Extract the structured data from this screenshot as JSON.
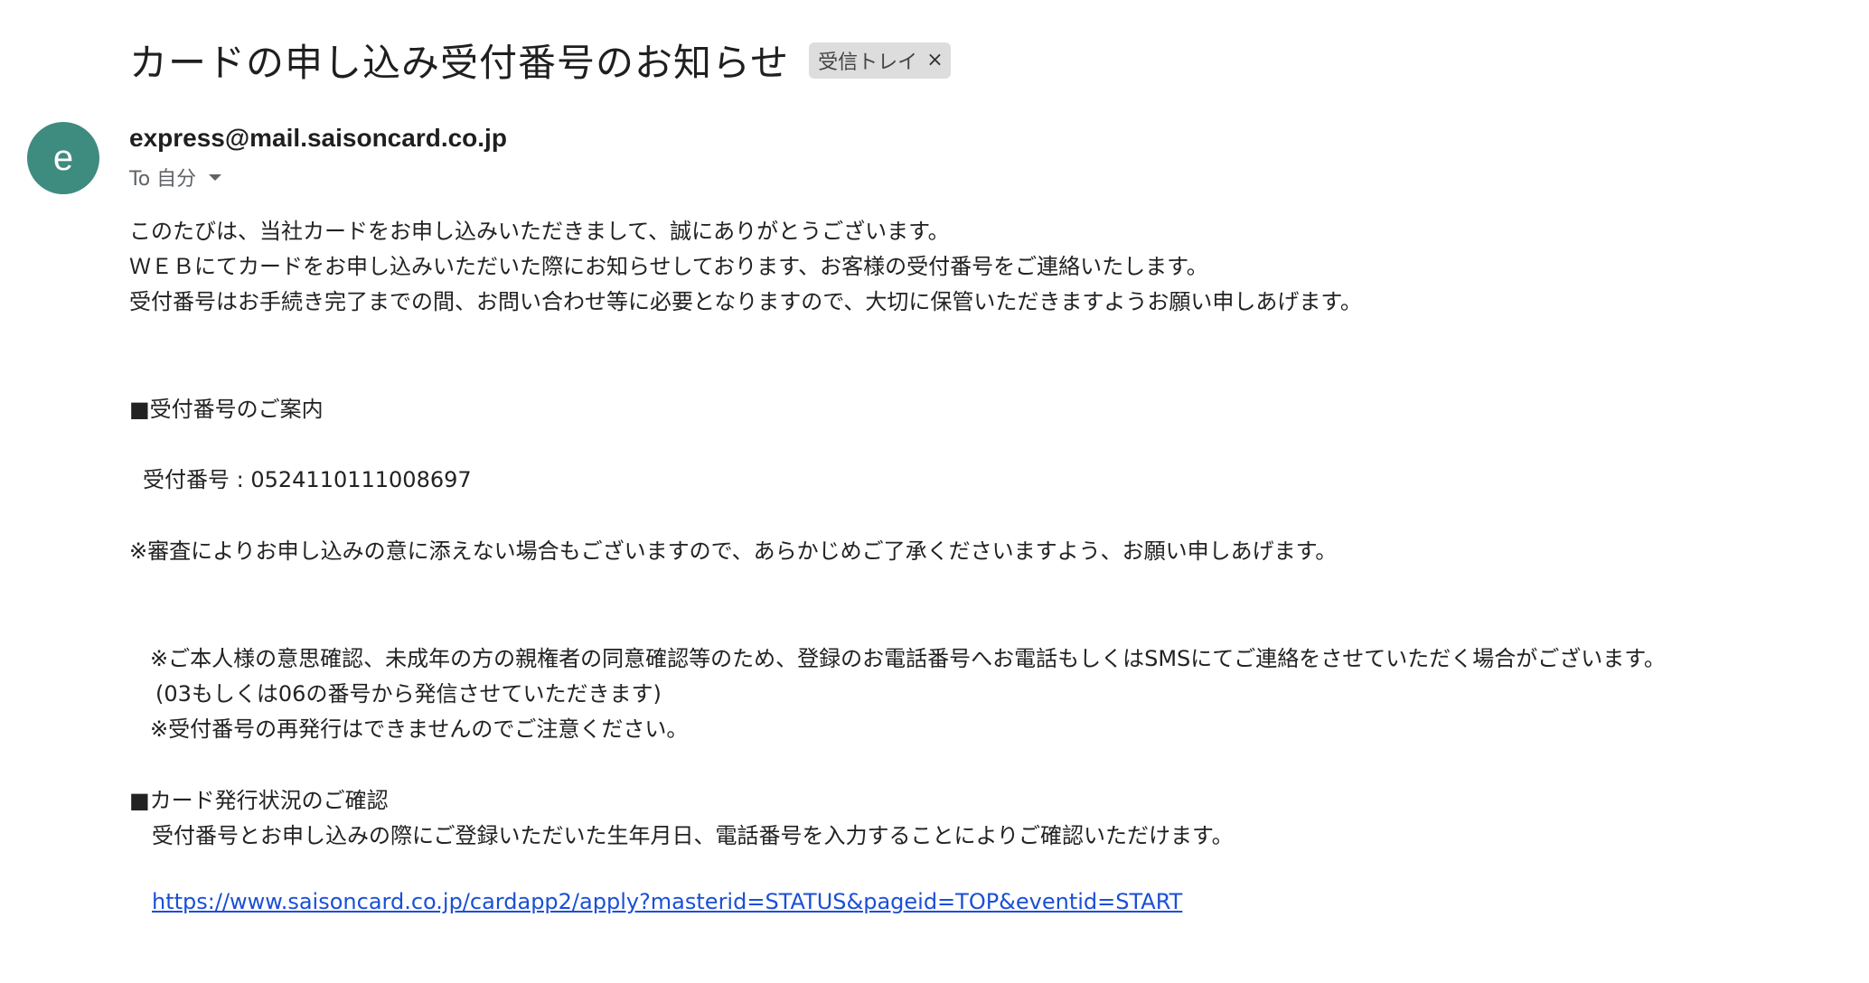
{
  "email": {
    "subject": "カードの申し込み受付番号のお知らせ",
    "label_chip": "受信トレイ",
    "label_chip_close": "×",
    "avatar_initial": "e",
    "avatar_color": "#3e8b7f",
    "sender": "express@mail.saisoncard.co.jp",
    "recipient": "To 自分",
    "body": {
      "line1": "このたびは、当社カードをお申し込みいただきまして、誠にありがとうございます。",
      "line2": "ＷＥＢにてカードをお申し込みいただいた際にお知らせしております、お客様の受付番号をご連絡いたします。",
      "line3": "受付番号はお手続き完了までの間、お問い合わせ等に必要となりますので、大切に保管いただきますようお願い申しあげます。",
      "section1_heading": "■受付番号のご案内",
      "receipt_number_line": "受付番号 : 0524110111008697",
      "note1": "※審査によりお申し込みの意に添えない場合もございますので、あらかじめご了承くださいますよう、お願い申しあげます。",
      "note2": "※ご本人様の意思確認、未成年の方の親権者の同意確認等のため、登録のお電話番号へお電話もしくはSMSにてご連絡をさせていただく場合がございます。",
      "note2_cont": "(03もしくは06の番号から発信させていただきます)",
      "note3": "※受付番号の再発行はできませんのでご注意ください。",
      "section2_heading": "■カード発行状況のご確認",
      "section2_text": "受付番号とお申し込みの際にご登録いただいた生年月日、電話番号を入力することによりご確認いただけます。",
      "status_link": "https://www.saisoncard.co.jp/cardapp2/apply?masterid=STATUS&pageid=TOP&eventid=START"
    }
  }
}
